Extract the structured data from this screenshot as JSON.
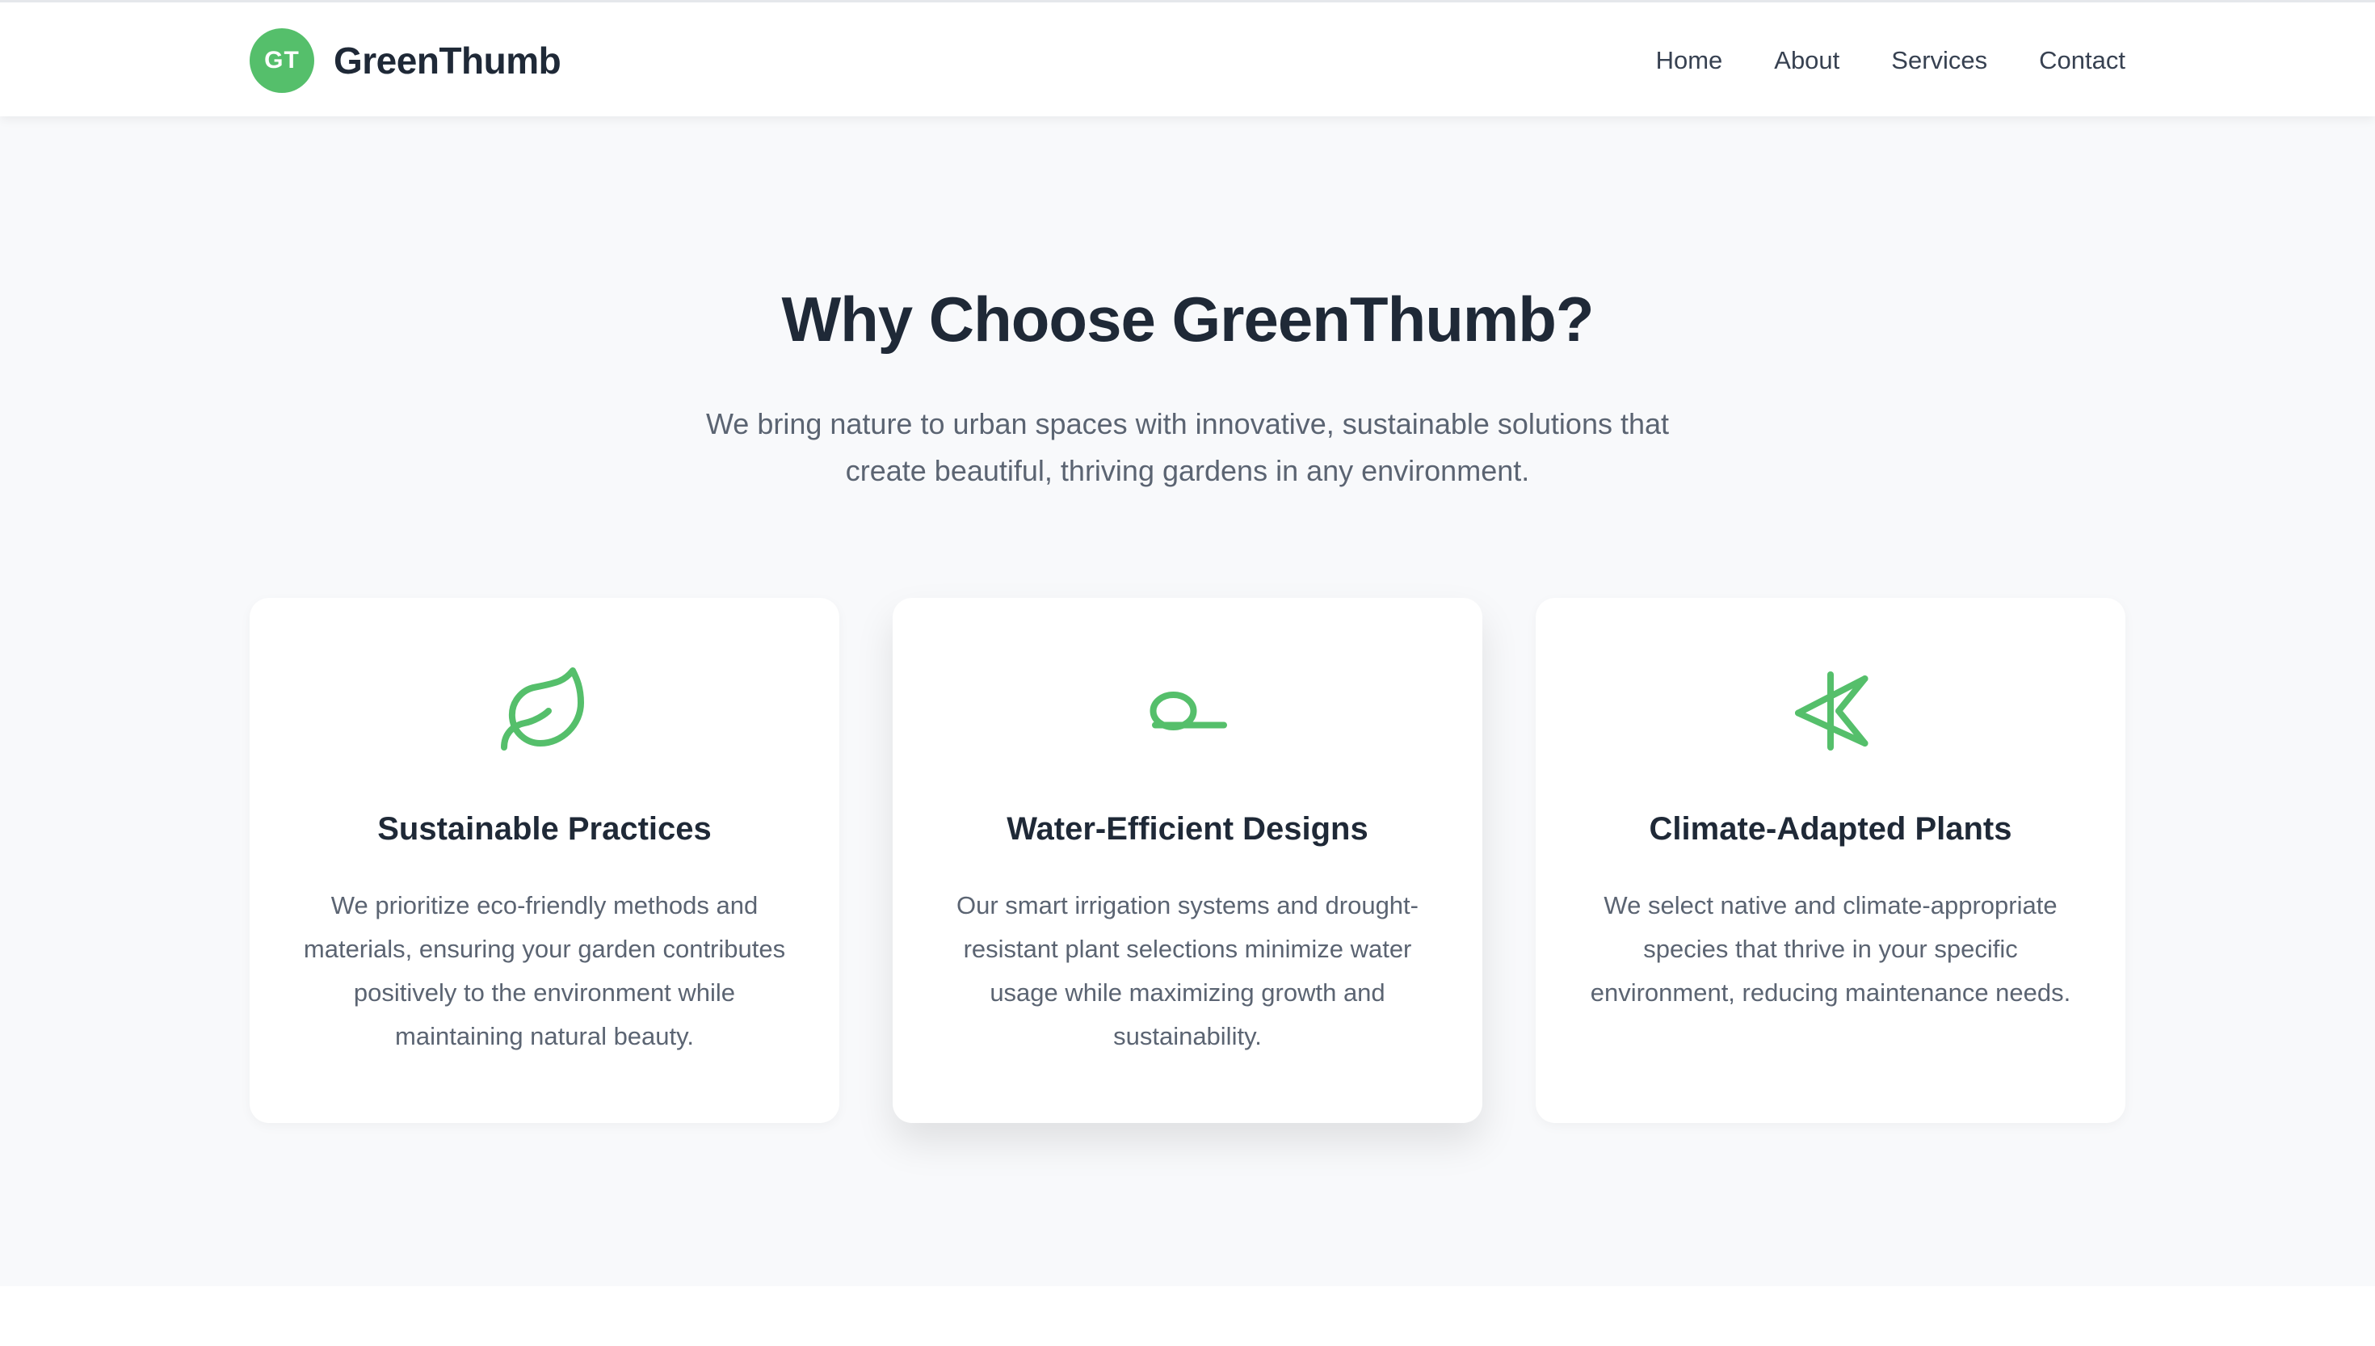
{
  "header": {
    "logo_initials": "GT",
    "brand": "GreenThumb",
    "nav": [
      {
        "label": "Home"
      },
      {
        "label": "About"
      },
      {
        "label": "Services"
      },
      {
        "label": "Contact"
      }
    ]
  },
  "hero": {
    "title": "Why Choose GreenThumb?",
    "subtitle": "We bring nature to urban spaces with innovative, sustainable solutions that create beautiful, thriving gardens in any environment."
  },
  "features": [
    {
      "icon": "leaf-icon",
      "title": "Sustainable Practices",
      "text": "We prioritize eco-friendly methods and materials, ensuring your garden contributes positively to the environment while maintaining natural beauty."
    },
    {
      "icon": "water-icon",
      "title": "Water-Efficient Designs",
      "text": "Our smart irrigation systems and drought-resistant plant selections minimize water usage while maximizing growth and sustainability."
    },
    {
      "icon": "climate-plant-icon",
      "title": "Climate-Adapted Plants",
      "text": "We select native and climate-appropriate species that thrive in your specific environment, reducing maintenance needs."
    }
  ],
  "colors": {
    "accent": "#55bf6b",
    "text_dark": "#1f2937",
    "text_muted": "#5b6472",
    "section_bg": "#f8f9fb"
  }
}
